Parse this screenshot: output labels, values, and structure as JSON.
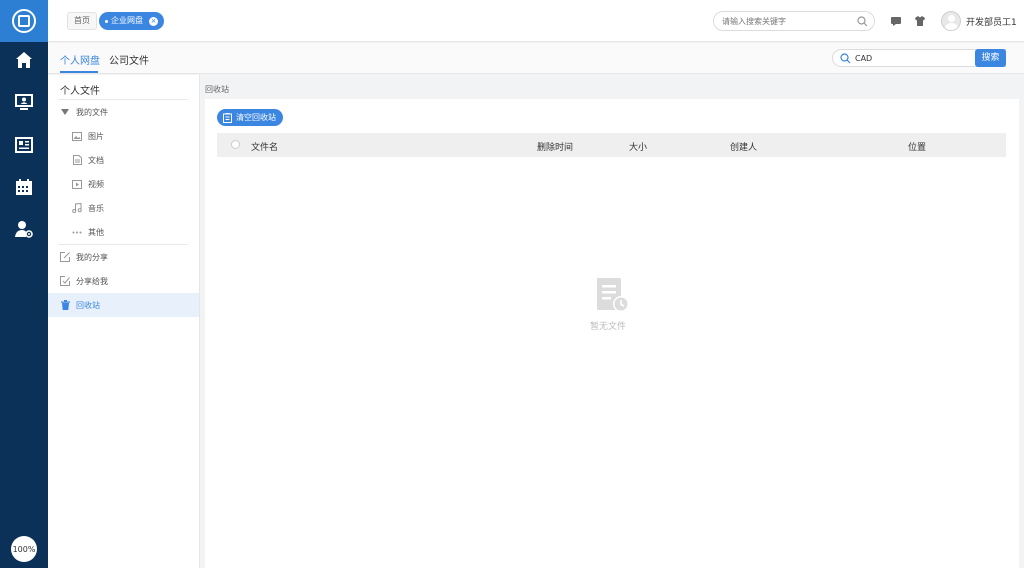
{
  "rail": {
    "icons": [
      "logo-icon",
      "home-icon",
      "monitor-user-icon",
      "news-icon",
      "calendar-icon",
      "user-settings-icon"
    ],
    "zoom_badge": "100%",
    "colors": {
      "background": "#0c3158",
      "logo_bg": "#2d7fd3"
    }
  },
  "topbar": {
    "breadcrumb": {
      "home": "首页",
      "active": "企业网盘"
    },
    "search": {
      "placeholder": "请输入搜索关键字",
      "value": ""
    },
    "user": {
      "name": "开发部员工1"
    }
  },
  "tabs": [
    {
      "label": "个人网盘",
      "active": true
    },
    {
      "label": "公司文件",
      "active": false
    }
  ],
  "main_search": {
    "value": "CAD",
    "button_label": "搜索"
  },
  "sidebar": {
    "title": "个人文件",
    "group": "我的文件",
    "sub_items": [
      {
        "label": "图片",
        "icon": "image-icon"
      },
      {
        "label": "文档",
        "icon": "document-icon"
      },
      {
        "label": "视频",
        "icon": "video-icon"
      },
      {
        "label": "音乐",
        "icon": "music-icon"
      },
      {
        "label": "其他",
        "icon": "more-icon"
      }
    ],
    "items": [
      {
        "label": "我的分享",
        "icon": "share-icon"
      },
      {
        "label": "分享给我",
        "icon": "shared-to-me-icon"
      },
      {
        "label": "回收站",
        "icon": "recycle-bin-icon",
        "active": true
      }
    ]
  },
  "content": {
    "section_label": "回收站",
    "clear_button": "清空回收站",
    "columns": [
      "文件名",
      "删除时间",
      "大小",
      "创建人",
      "位置"
    ],
    "empty_text": "暂无文件"
  },
  "colors": {
    "accent": "#3b86e0",
    "active_bg": "#e8f1fb"
  }
}
